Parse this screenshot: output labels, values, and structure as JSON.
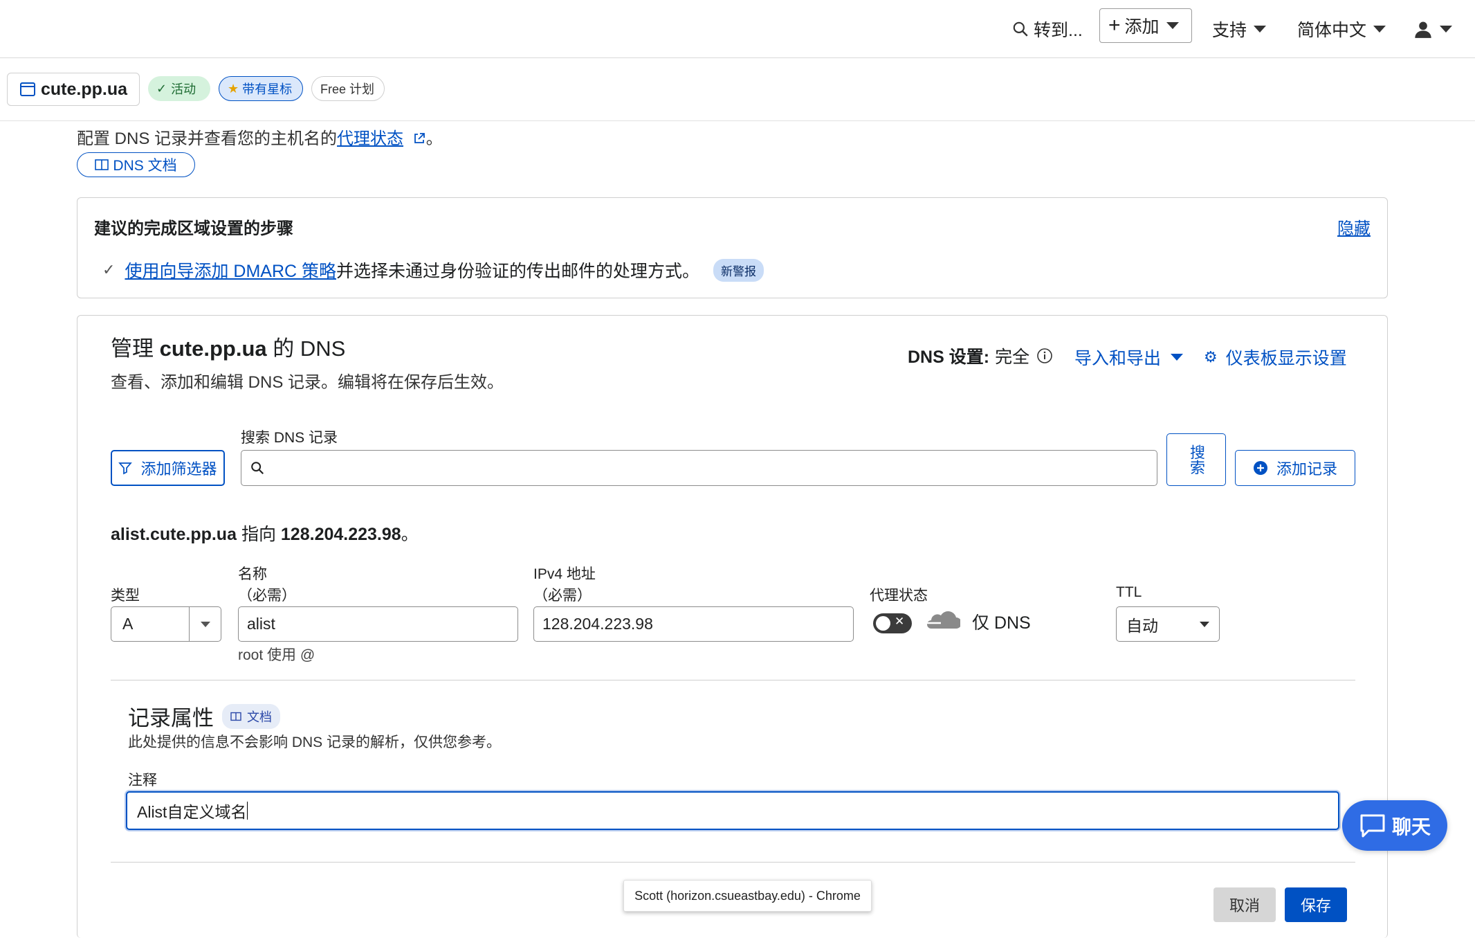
{
  "topbar": {
    "goto_label": "转到...",
    "add_label": "添加",
    "support_label": "支持",
    "language_label": "简体中文"
  },
  "zone": {
    "name": "cute.pp.ua",
    "status_badge": "活动",
    "starred_badge": "带有星标",
    "plan_badge": "Free 计划"
  },
  "intro": {
    "text": "配置 DNS 记录并查看您的主机名的",
    "proxy_link": "代理状态",
    "suffix": "。",
    "docs_button": "DNS 文档"
  },
  "steps_card": {
    "title": "建议的完成区域设置的步骤",
    "hide_link": "隐藏",
    "step_link": "使用向导添加 DMARC 策略",
    "step_text": "并选择未通过身份验证的传出邮件的处理方式。",
    "step_badge": "新警报"
  },
  "dns_card": {
    "title_prefix": "管理",
    "title_zone": "cute.pp.ua",
    "title_suffix": "的 DNS",
    "subtitle": "查看、添加和编辑 DNS 记录。编辑将在保存后生效。",
    "dns_setting_label": "DNS 设置:",
    "dns_setting_value": "完全",
    "import_export": "导入和导出",
    "dashboard_settings": "仪表板显示设置",
    "filter_button": "添加筛选器",
    "search_label": "搜索 DNS 记录",
    "search_placeholder": "",
    "search_button": "搜索",
    "add_record_button": "添加记录"
  },
  "record": {
    "summary_host": "alist.cute.pp.ua",
    "summary_mid": "指向",
    "summary_ip": "128.204.223.98",
    "summary_end": "。",
    "type_label": "类型",
    "type_value": "A",
    "name_label": "名称",
    "name_required": "（必需）",
    "name_value": "alist",
    "name_hint": "root 使用 @",
    "ipv4_label": "IPv4 地址",
    "ipv4_required": "（必需）",
    "ipv4_value": "128.204.223.98",
    "proxy_label": "代理状态",
    "proxy_value": "仅 DNS",
    "ttl_label": "TTL",
    "ttl_value": "自动"
  },
  "attributes": {
    "title": "记录属性",
    "docs_badge": "文档",
    "description": "此处提供的信息不会影响 DNS 记录的解析，仅供您参考。",
    "comment_label": "注释",
    "comment_value": "Alist自定义域名"
  },
  "footer": {
    "tooltip": "Scott (horizon.csueastbay.edu) - Chrome",
    "cancel_button": "取消",
    "save_button": "保存",
    "chat_button": "聊天"
  },
  "colors": {
    "accent": "#0051c3",
    "active_green": "#d5f2dd",
    "badge_blue": "#dbe8fb",
    "chat_blue": "#2f6ce5"
  }
}
